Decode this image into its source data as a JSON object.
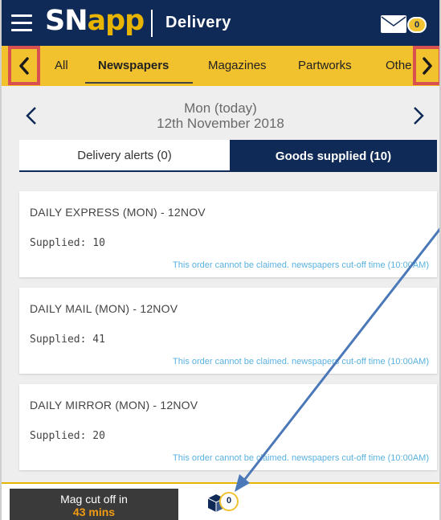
{
  "header": {
    "logo_sn": "SN",
    "logo_app": "app",
    "title": "Delivery",
    "mail_count": "0"
  },
  "tabs": [
    {
      "label": "All"
    },
    {
      "label": "Newspapers"
    },
    {
      "label": "Magazines"
    },
    {
      "label": "Partworks"
    },
    {
      "label": "Othe"
    }
  ],
  "date": {
    "day": "Mon (today)",
    "full": "12th November 2018"
  },
  "sub_tabs": {
    "alerts": "Delivery alerts (0)",
    "goods": "Goods supplied (10)"
  },
  "orders": [
    {
      "title": "DAILY EXPRESS (MON) - 12NOV",
      "supplied": "Supplied: 10",
      "note": "This order cannot be claimed. newspapers cut-off time (10:00AM)"
    },
    {
      "title": "DAILY MAIL (MON) - 12NOV",
      "supplied": "Supplied: 41",
      "note": "This order cannot be claimed. newspapers cut-off time (10:00AM)"
    },
    {
      "title": "DAILY MIRROR (MON) - 12NOV",
      "supplied": "Supplied: 20",
      "note": "This order cannot be claimed. newspapers cut-off time (10:00AM)"
    }
  ],
  "bottom": {
    "mag_label": "Mag cut off in",
    "mag_value": "43 mins",
    "box_count": "0"
  },
  "colors": {
    "header_bg": "#0f2a56",
    "accent_yellow": "#f2c12e",
    "highlight_red": "#d85050",
    "note_blue": "#5ab1df",
    "cutoff_orange": "#f39c12",
    "annotation_arrow": "#4a78b8"
  },
  "icons": [
    "menu-icon",
    "mail-icon",
    "chevron-left-icon",
    "chevron-right-icon",
    "box-icon"
  ]
}
